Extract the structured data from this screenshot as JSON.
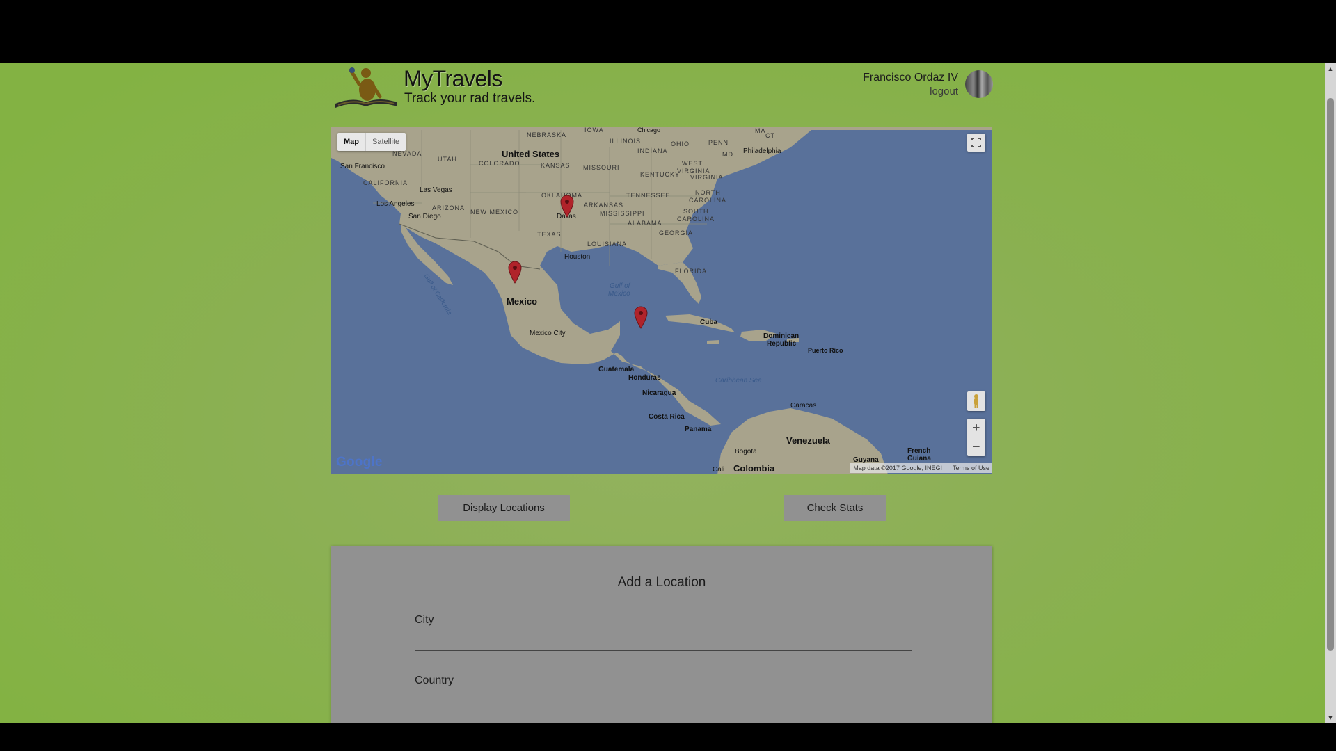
{
  "app": {
    "title": "MyTravels",
    "tagline": "Track your rad travels."
  },
  "user": {
    "name": "Francisco Ordaz IV",
    "logout_label": "logout"
  },
  "map": {
    "type_buttons": [
      "Map",
      "Satellite"
    ],
    "selected_type": "Map",
    "google_logo": "Google",
    "attribution": "Map data ©2017 Google, INEGI",
    "terms": "Terms of Use",
    "zoom_in": "+",
    "zoom_out": "−",
    "labels": {
      "united_states": "United States",
      "mexico": "Mexico",
      "cuba": "Cuba",
      "venezuela": "Venezuela",
      "colombia": "Colombia",
      "guatemala": "Guatemala",
      "honduras": "Honduras",
      "nicaragua": "Nicaragua",
      "costa_rica": "Costa Rica",
      "panama": "Panama",
      "dominican_republic_1": "Dominican",
      "dominican_republic_2": "Republic",
      "puerto_rico": "Puerto Rico",
      "caribbean_sea": "Caribbean Sea",
      "gulf_of_mexico_1": "Gulf of",
      "gulf_of_mexico_2": "Mexico",
      "gulf_of_california": "Gulf of California",
      "french_guiana_1": "French",
      "french_guiana_2": "Guiana",
      "guyana": "Guyana",
      "caracas": "Caracas",
      "bogota": "Bogota",
      "cali": "Cali",
      "mexico_city": "Mexico City",
      "houston": "Houston",
      "dallas": "Dallas",
      "san_francisco": "San Francisco",
      "los_angeles": "Los Angeles",
      "san_diego": "San Diego",
      "las_vegas": "Las Vegas",
      "philadelphia": "Philadelphia",
      "chicago": "Chicago",
      "nebraska": "NEBRASKA",
      "iowa": "IOWA",
      "illinois": "ILLINOIS",
      "indiana": "INDIANA",
      "ohio": "OHIO",
      "penn": "PENN",
      "nevada": "NEVADA",
      "utah": "UTAH",
      "colorado": "COLORADO",
      "kansas": "KANSAS",
      "missouri": "MISSOURI",
      "kentucky": "KENTUCKY",
      "west_virginia_1": "WEST",
      "west_virginia_2": "VIRGINIA",
      "virginia": "VIRGINIA",
      "california": "CALIFORNIA",
      "arizona": "ARIZONA",
      "new_mexico": "NEW MEXICO",
      "oklahoma": "OKLAHOMA",
      "arkansas": "ARKANSAS",
      "tennessee": "TENNESSEE",
      "north_carolina_1": "NORTH",
      "north_carolina_2": "CAROLINA",
      "south_carolina_1": "SOUTH",
      "south_carolina_2": "CAROLINA",
      "mississippi": "MISSISSIPPI",
      "alabama": "ALABAMA",
      "georgia": "GEORGIA",
      "texas": "TEXAS",
      "louisiana": "LOUISIANA",
      "florida": "FLORIDA",
      "maryland": "MD",
      "massachusetts": "MA",
      "connecticut": "CT"
    },
    "markers": [
      {
        "name": "Dallas"
      },
      {
        "name": "Northern Mexico"
      },
      {
        "name": "Yucatan"
      }
    ]
  },
  "actions": {
    "display_locations": "Display Locations",
    "check_stats": "Check Stats"
  },
  "add_location": {
    "title": "Add a Location",
    "city_label": "City",
    "city_value": "",
    "country_label": "Country",
    "country_value": ""
  },
  "colors": {
    "page_green": "#8cb055",
    "water": "#59719a",
    "land": "#a8a38c",
    "marker": "#b0232a",
    "button": "#919191"
  }
}
